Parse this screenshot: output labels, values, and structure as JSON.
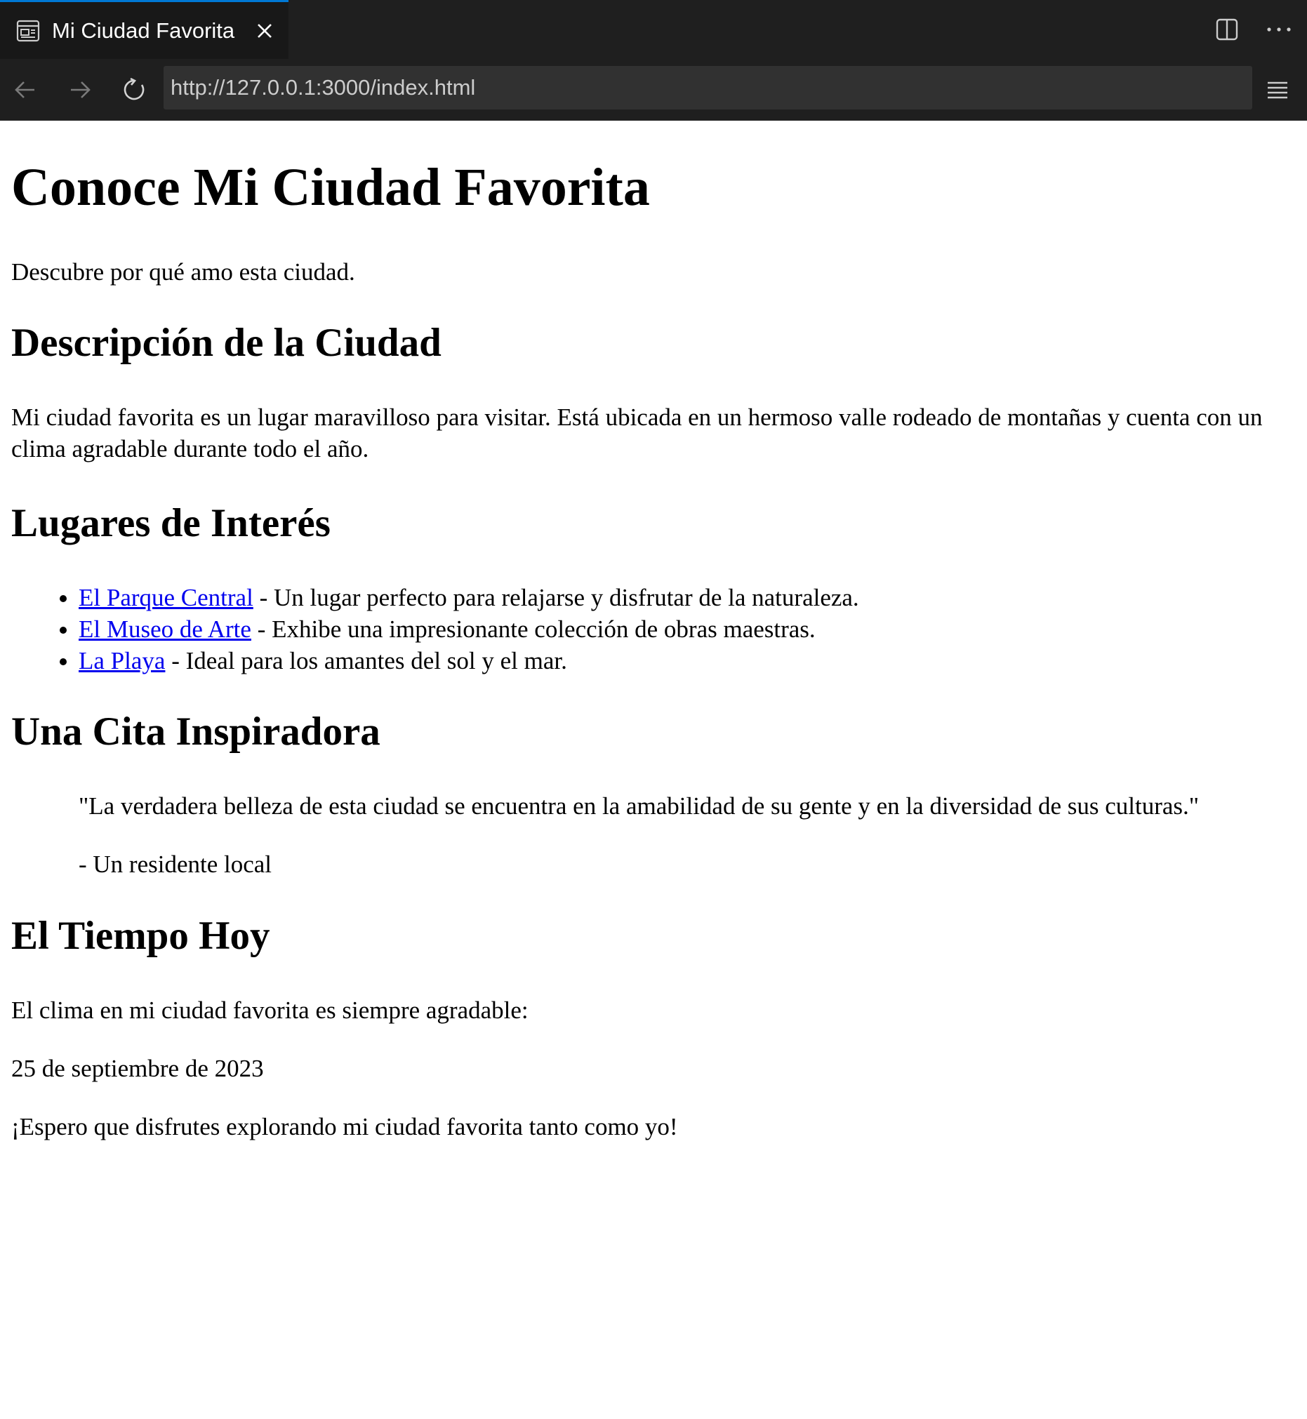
{
  "browser": {
    "tab_title": "Mi Ciudad Favorita",
    "url": "http://127.0.0.1:3000/index.html",
    "icons": {
      "tab": "page-icon",
      "close": "close-icon",
      "split": "split-editor-icon",
      "more": "more-icon",
      "back": "back-arrow-icon",
      "forward": "forward-arrow-icon",
      "reload": "reload-icon",
      "menu": "hamburger-menu-icon"
    },
    "colors": {
      "chrome_bg": "#1f1f1f",
      "active_tab_accent": "#0078d4",
      "url_bar_bg": "#313131"
    }
  },
  "page": {
    "title": "Conoce Mi Ciudad Favorita",
    "intro": "Descubre por qué amo esta ciudad.",
    "description": {
      "heading": "Descripción de la Ciudad",
      "text": "Mi ciudad favorita es un lugar maravilloso para visitar. Está ubicada en un hermoso valle rodeado de montañas y cuenta con un clima agradable durante todo el año."
    },
    "places": {
      "heading": "Lugares de Interés",
      "items": [
        {
          "link": "El Parque Central",
          "text": " - Un lugar perfecto para relajarse y disfrutar de la naturaleza."
        },
        {
          "link": "El Museo de Arte",
          "text": " - Exhibe una impresionante colección de obras maestras."
        },
        {
          "link": "La Playa",
          "text": " - Ideal para los amantes del sol y el mar."
        }
      ]
    },
    "quote": {
      "heading": "Una Cita Inspiradora",
      "text": "\"La verdadera belleza de esta ciudad se encuentra en la amabilidad de su gente y en la diversidad de sus culturas.\"",
      "author": "- Un residente local"
    },
    "weather": {
      "heading": "El Tiempo Hoy",
      "text": "El clima en mi ciudad favorita es siempre agradable:",
      "date": "25 de septiembre de 2023"
    },
    "closing": "¡Espero que disfrutes explorando mi ciudad favorita tanto como yo!",
    "colors": {
      "link": "#0000ee",
      "text": "#000000"
    }
  }
}
